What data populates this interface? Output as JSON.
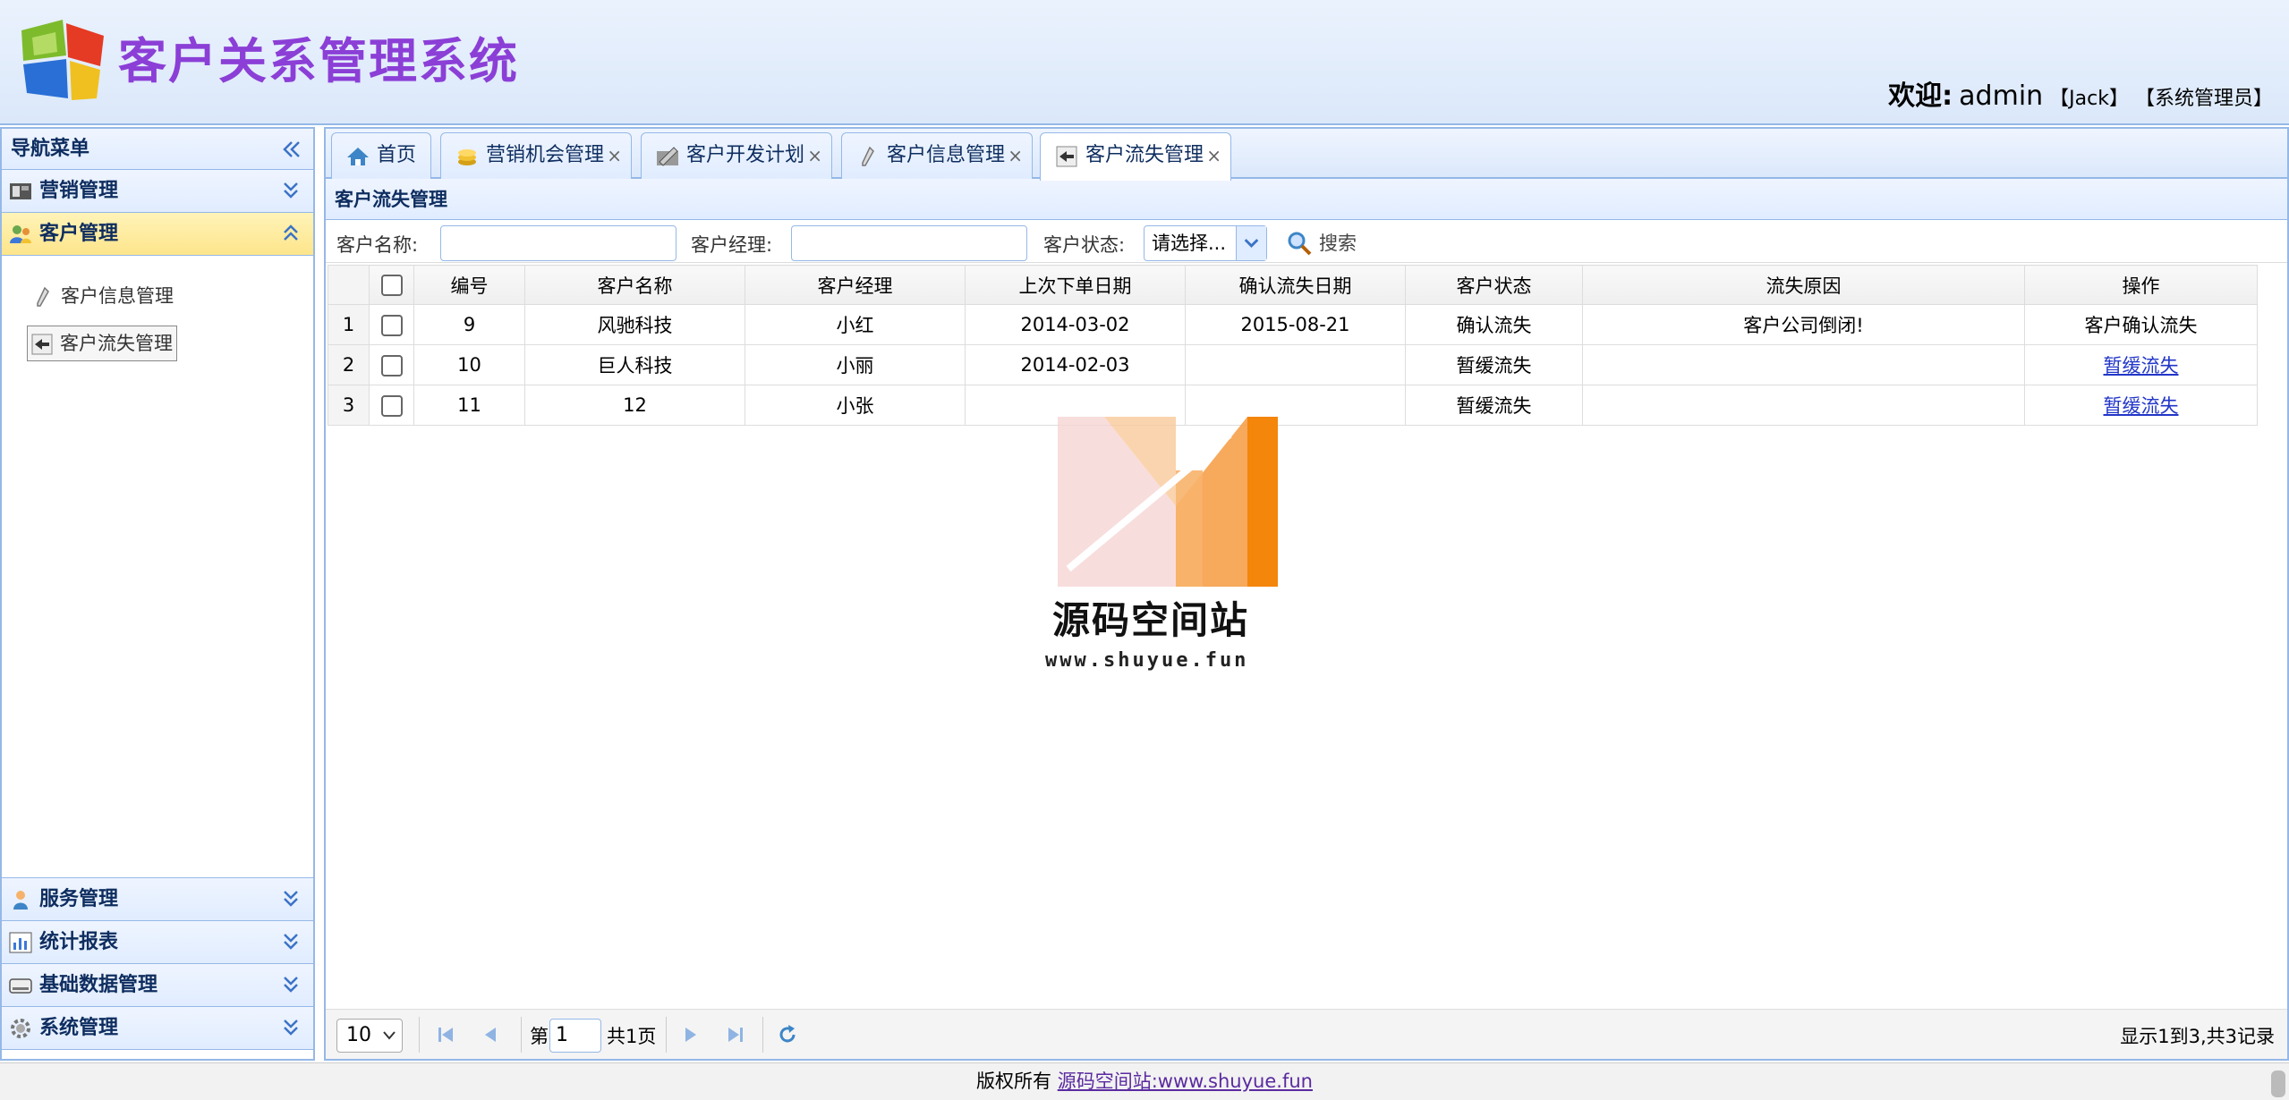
{
  "header": {
    "title": "客户关系管理系统",
    "welcome_label": "欢迎:",
    "username": "admin",
    "realname": "【Jack】",
    "role": "【系统管理员】"
  },
  "sidebar": {
    "title": "导航菜单",
    "groups": [
      {
        "label": "营销管理",
        "icon": "marketing-icon",
        "expanded": false
      },
      {
        "label": "客户管理",
        "icon": "customer-icon",
        "expanded": true,
        "items": [
          {
            "label": "客户信息管理",
            "icon": "pen-icon"
          },
          {
            "label": "客户流失管理",
            "icon": "lost-icon",
            "selected": true
          }
        ]
      },
      {
        "label": "服务管理",
        "icon": "service-icon",
        "expanded": false
      },
      {
        "label": "统计报表",
        "icon": "chart-icon",
        "expanded": false
      },
      {
        "label": "基础数据管理",
        "icon": "database-icon",
        "expanded": false
      },
      {
        "label": "系统管理",
        "icon": "gear-icon",
        "expanded": false
      }
    ]
  },
  "tabs": [
    {
      "label": "首页",
      "icon": "home-icon",
      "closable": false
    },
    {
      "label": "营销机会管理",
      "icon": "coins-icon",
      "closable": true
    },
    {
      "label": "客户开发计划",
      "icon": "plan-icon",
      "closable": true
    },
    {
      "label": "客户信息管理",
      "icon": "pen-icon",
      "closable": true
    },
    {
      "label": "客户流失管理",
      "icon": "lost-icon",
      "closable": true,
      "active": true
    }
  ],
  "tab_close_glyph": "×",
  "panel": {
    "title": "客户流失管理",
    "filters": {
      "name_label": "客户名称:",
      "name_value": "",
      "manager_label": "客户经理:",
      "manager_value": "",
      "status_label": "客户状态:",
      "status_value": "请选择...",
      "search_label": "搜索"
    }
  },
  "grid": {
    "columns": [
      "编号",
      "客户名称",
      "客户经理",
      "上次下单日期",
      "确认流失日期",
      "客户状态",
      "流失原因",
      "操作"
    ],
    "rows": [
      {
        "rn": "1",
        "id": "9",
        "name": "风驰科技",
        "manager": "小红",
        "last_order": "2014-03-02",
        "confirm_date": "2015-08-21",
        "status": "确认流失",
        "reason": "客户公司倒闭!",
        "action": "客户确认流失",
        "action_link": false
      },
      {
        "rn": "2",
        "id": "10",
        "name": "巨人科技",
        "manager": "小丽",
        "last_order": "2014-02-03",
        "confirm_date": "",
        "status": "暂缓流失",
        "reason": "",
        "action": "暂缓流失",
        "action_link": true
      },
      {
        "rn": "3",
        "id": "11",
        "name": "12",
        "manager": "小张",
        "last_order": "",
        "confirm_date": "",
        "status": "暂缓流失",
        "reason": "",
        "action": "暂缓流失",
        "action_link": true
      }
    ]
  },
  "watermark": {
    "title": "源码空间站",
    "url": "www.shuyue.fun"
  },
  "pager": {
    "page_size": "10",
    "page_prefix": "第",
    "page_value": "1",
    "page_total": "共1页",
    "info": "显示1到3,共3记录"
  },
  "footer": {
    "text": "版权所有",
    "link": "源码空间站:www.shuyue.fun"
  },
  "colors": {
    "border": "#95b8e7",
    "title_purple": "#8b3fd6",
    "active_group": "#fde58b",
    "link": "#2236c8"
  }
}
